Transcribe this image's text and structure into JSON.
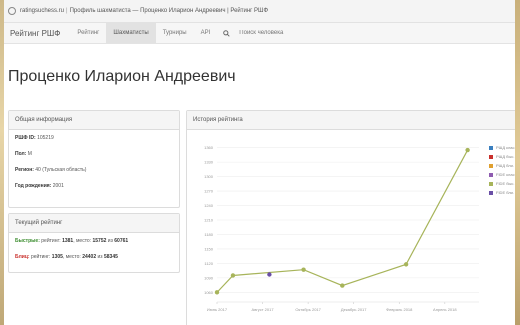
{
  "browser": {
    "url": "ratingsuchess.ru",
    "tab_title": "Профиль шахматиста — Проценко Иларион Андреевич | Рейтинг РШФ"
  },
  "nav": {
    "brand": "Рейтинг РШФ",
    "items": [
      "Рейтинг",
      "Шахматисты",
      "Турниры",
      "API"
    ],
    "active_index": 1,
    "search_placeholder": "Поиск человека"
  },
  "page_title": "Проценко Иларион Андреевич",
  "info": {
    "heading": "Общая информация",
    "rows": [
      {
        "label": "РШФ ID:",
        "value": "105219"
      },
      {
        "label": "Пол:",
        "value": "M"
      },
      {
        "label": "Регион:",
        "value": "40 (Тульская область)"
      },
      {
        "label": "Год рождения:",
        "value": "2001"
      }
    ]
  },
  "current_rating": {
    "heading": "Текущий рейтинг",
    "fast": {
      "label": "Быстрые:",
      "rating_text": "рейтинг:",
      "rating": "1381",
      "place_text": ", место:",
      "place": "15752",
      "of_text": "из",
      "of": "60761"
    },
    "blitz": {
      "label": "Блиц:",
      "rating_text": "рейтинг:",
      "rating": "1305",
      "place_text": ", место:",
      "place": "24402",
      "of_text": "из",
      "of": "58345"
    }
  },
  "history": {
    "heading": "История рейтинга",
    "legend": [
      {
        "name": "РШД клас.",
        "color": "#3a7fbf"
      },
      {
        "name": "РШД быс.",
        "color": "#c9302c"
      },
      {
        "name": "РШД бли.",
        "color": "#e0a030"
      },
      {
        "name": "FIDE клас.",
        "color": "#8e5cb0"
      },
      {
        "name": "FIDE быс.",
        "color": "#a7b45a"
      },
      {
        "name": "FIDE бли.",
        "color": "#6a4fa6"
      }
    ]
  },
  "chart_data": {
    "type": "line",
    "title": "",
    "xlabel": "",
    "ylabel": "",
    "ylim": [
      1040,
      1380
    ],
    "yticks": [
      1060,
      1090,
      1120,
      1150,
      1180,
      1210,
      1240,
      1270,
      1300,
      1330,
      1360
    ],
    "x_tick_labels": [
      "Июнь 2017",
      "Август 2017",
      "Октябрь 2017",
      "Декабрь 2017",
      "Февраль 2018",
      "Апрель 2018"
    ],
    "xlim_months": [
      0,
      11.5
    ],
    "grid": true,
    "series": [
      {
        "name": "",
        "color": "#a7b45a",
        "x": [
          0,
          0.7,
          3.8,
          5.5,
          8.3,
          11
        ],
        "y": [
          1060,
          1095,
          1107,
          1074,
          1118,
          1355
        ]
      },
      {
        "name": "",
        "color": "#6a4fa6",
        "x": [
          2.3
        ],
        "y": [
          1097
        ]
      }
    ]
  }
}
